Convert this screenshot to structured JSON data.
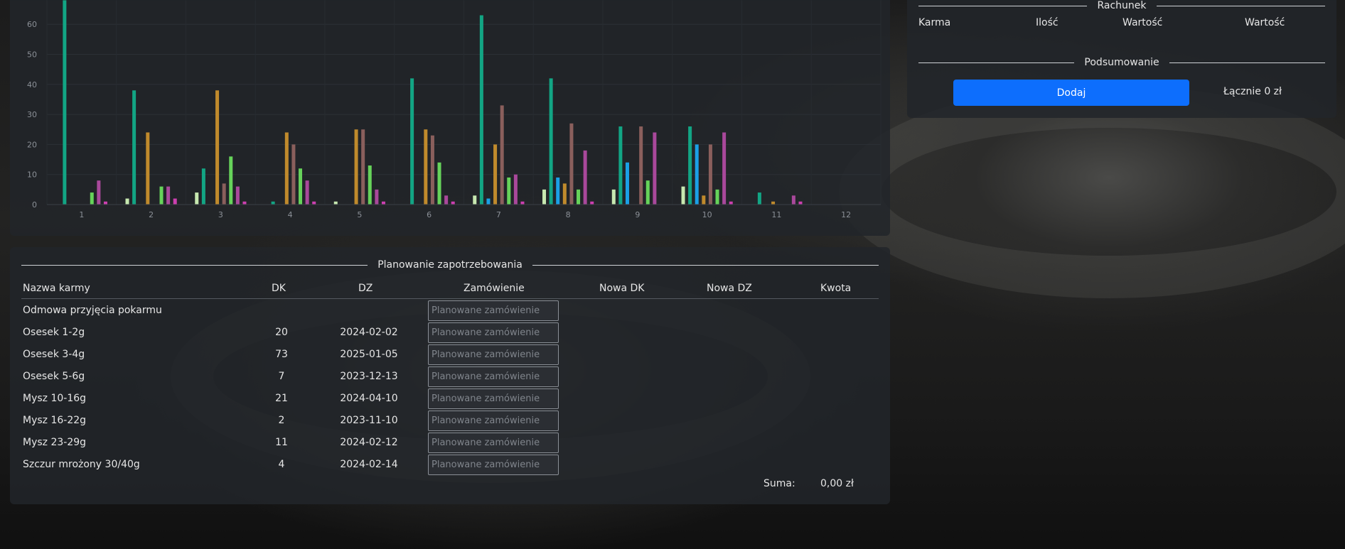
{
  "chart_data": {
    "type": "bar",
    "categories": [
      "1",
      "2",
      "3",
      "4",
      "5",
      "6",
      "7",
      "8",
      "9",
      "10",
      "11",
      "12"
    ],
    "y_ticks": [
      0,
      10,
      20,
      30,
      40,
      50,
      60
    ],
    "ylim": [
      0,
      68
    ],
    "grid": true,
    "colors": [
      "#c7e8b0",
      "#12a584",
      "#1ba0e6",
      "#c08a2c",
      "#8a5f5c",
      "#66d35a",
      "#a9489b",
      "#cd3fb0"
    ],
    "series": [
      {
        "values": [
          0,
          2,
          4,
          0,
          1,
          0,
          3,
          5,
          5,
          6,
          0,
          0
        ]
      },
      {
        "values": [
          68,
          38,
          12,
          1,
          0,
          42,
          63,
          42,
          26,
          26,
          4,
          0
        ]
      },
      {
        "values": [
          0,
          0,
          0,
          0,
          0,
          0,
          2,
          9,
          14,
          20,
          0,
          0
        ]
      },
      {
        "values": [
          0,
          24,
          38,
          24,
          25,
          25,
          20,
          7,
          0,
          3,
          1,
          0
        ]
      },
      {
        "values": [
          0,
          0,
          7,
          20,
          25,
          23,
          33,
          27,
          26,
          20,
          0,
          0
        ]
      },
      {
        "values": [
          4,
          6,
          16,
          12,
          13,
          14,
          9,
          5,
          8,
          5,
          0,
          0
        ]
      },
      {
        "values": [
          8,
          6,
          6,
          8,
          5,
          3,
          10,
          18,
          24,
          24,
          3,
          0
        ]
      },
      {
        "values": [
          1,
          2,
          1,
          1,
          1,
          1,
          1,
          1,
          0,
          1,
          1,
          0
        ]
      }
    ]
  },
  "bill": {
    "title": "Rachunek",
    "col_karma": "Karma",
    "col_ilosc": "Ilość",
    "col_wartosc1": "Wartość",
    "col_wartosc2": "Wartość",
    "summary_title": "Podsumowanie",
    "add_label": "Dodaj",
    "total": "Łącznie 0 zł"
  },
  "plan": {
    "title": "Planowanie zapotrzebowania",
    "headers": {
      "name": "Nazwa karmy",
      "dk": "DK",
      "dz": "DZ",
      "order": "Zamówienie",
      "new_dk": "Nowa DK",
      "new_dz": "Nowa DZ",
      "amount": "Kwota"
    },
    "placeholder": "Planowane zamówienie",
    "rows": [
      {
        "name": "Odmowa przyjęcia pokarmu",
        "dk": "",
        "dz": ""
      },
      {
        "name": "Osesek 1-2g",
        "dk": "20",
        "dz": "2024-02-02"
      },
      {
        "name": "Osesek 3-4g",
        "dk": "73",
        "dz": "2025-01-05"
      },
      {
        "name": "Osesek 5-6g",
        "dk": "7",
        "dz": "2023-12-13"
      },
      {
        "name": "Mysz 10-16g",
        "dk": "21",
        "dz": "2024-04-10"
      },
      {
        "name": "Mysz 16-22g",
        "dk": "2",
        "dz": "2023-11-10"
      },
      {
        "name": "Mysz 23-29g",
        "dk": "11",
        "dz": "2024-02-12"
      },
      {
        "name": "Szczur mrożony 30/40g",
        "dk": "4",
        "dz": "2024-02-14"
      }
    ],
    "sum_label": "Suma:",
    "sum_value": "0,00 zł"
  }
}
